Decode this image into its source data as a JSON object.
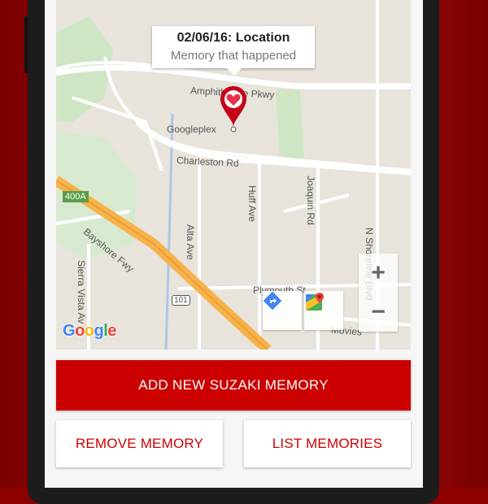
{
  "map": {
    "info_title": "02/06/16: Location",
    "info_subtitle": "Memory that happened",
    "marker_icon": "heart-pin-icon",
    "labels": {
      "amphitheatre": "Amphitheatre Pkwy",
      "googleplex": "Googleplex",
      "charleston": "Charleston Rd",
      "hwy_400a": "400A",
      "huff": "Huff Ave",
      "joaquin": "Joaquin Rd",
      "bayshore": "Bayshore Fwy",
      "alta": "Alta Ave",
      "sierra": "Sierra Vista Av",
      "n_shoreline": "N Shoreline Blvd",
      "plymouth": "Plymouth St",
      "hwy_101": "101",
      "movies": "Movies"
    },
    "zoom_in": "+",
    "zoom_out": "−",
    "logo": "Google"
  },
  "actions": {
    "add": "ADD NEW SUZAKI MEMORY",
    "remove": "REMOVE MEMORY",
    "list": "LIST MEMORIES"
  },
  "colors": {
    "accent": "#cc0000",
    "background": "#8e0000"
  }
}
